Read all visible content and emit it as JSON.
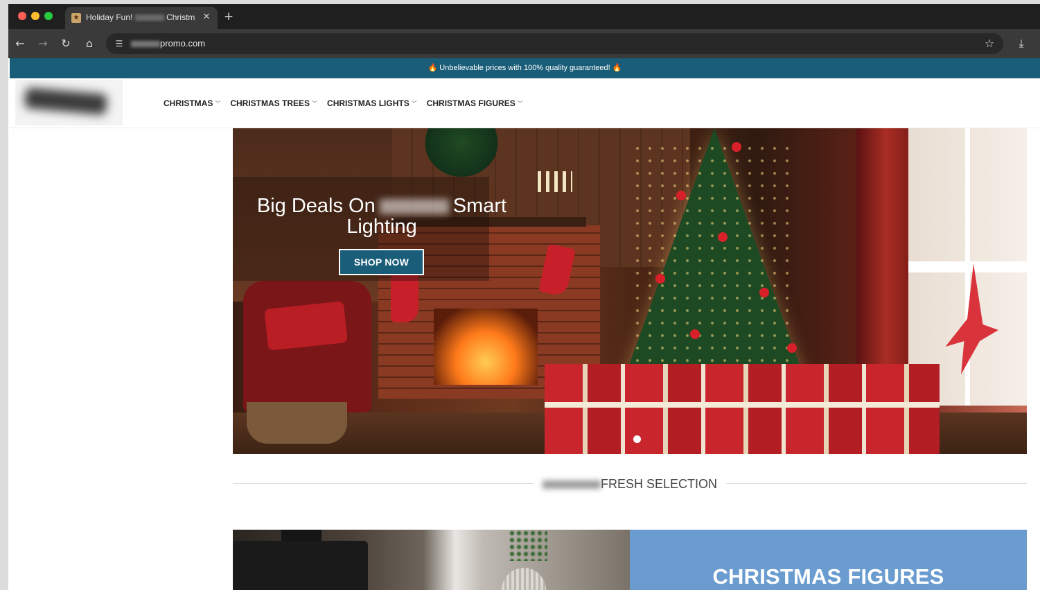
{
  "browser": {
    "tab": {
      "title_prefix": "Holiday Fun!",
      "title_suffix": "Christm"
    },
    "url_suffix": "promo.com",
    "icons": {
      "close": "close-icon",
      "new_tab": "plus-icon",
      "back": "back-arrow-icon",
      "forward": "forward-arrow-icon",
      "reload": "reload-icon",
      "home": "home-icon",
      "site_info": "tune-icon",
      "bookmark": "star-icon",
      "download": "download-icon"
    }
  },
  "announcement": {
    "text": "🔥 Unbelievable prices with 100% quality guaranteed! 🔥",
    "background": "#1a5d78"
  },
  "nav": {
    "items": [
      {
        "label": "CHRISTMAS"
      },
      {
        "label": "CHRISTMAS TREES"
      },
      {
        "label": "CHRISTMAS LIGHTS"
      },
      {
        "label": "CHRISTMAS FIGURES"
      }
    ]
  },
  "hero": {
    "title_start": "Big Deals On",
    "title_end": "Smart Lighting",
    "button_label": "SHOP NOW",
    "button_color": "#1a5d78"
  },
  "section": {
    "title": "FRESH SELECTION"
  },
  "categories": [
    {
      "label": "CHRISTMAS FIGURES",
      "color": "#6a9ccf"
    }
  ]
}
